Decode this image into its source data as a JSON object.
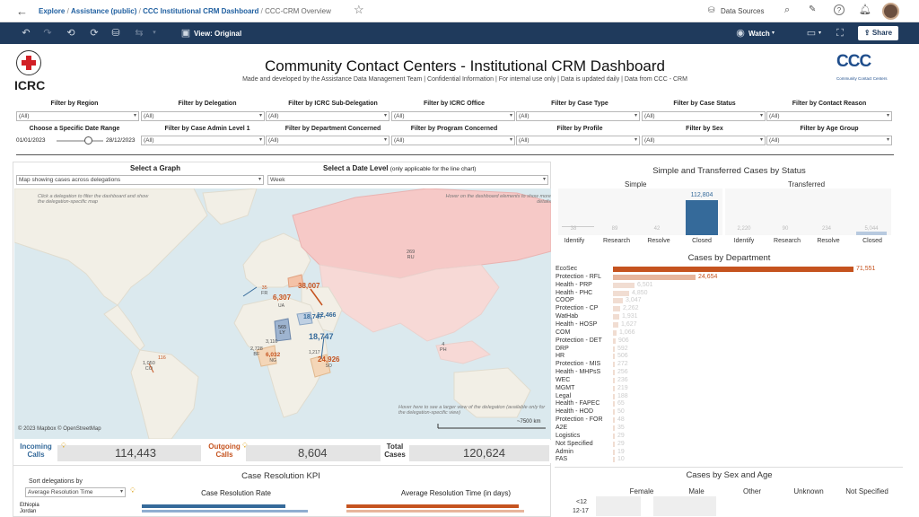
{
  "topbar": {
    "breadcrumbs": [
      "Explore",
      "Assistance (public)",
      "CCC Institutional CRM Dashboard",
      "CCC-CRM Overview"
    ],
    "data_sources": "Data Sources"
  },
  "toolbar": {
    "view": "View: Original",
    "watch": "Watch",
    "share": "Share"
  },
  "header": {
    "logo_text": "ICRC",
    "title": "Community Contact Centers - Institutional CRM Dashboard",
    "subtitle": "Made and developed by the Assistance Data Management Team | Confidential Information | For internal use only | Data is updated daily | Data from CCC - CRM",
    "ccc_logo": "CCC",
    "ccc_caption": "Community Contact Centers"
  },
  "filters": {
    "row1": [
      {
        "label": "Filter by Region",
        "value": "(All)"
      },
      {
        "label": "Filter by Delegation",
        "value": "(All)"
      },
      {
        "label": "Filter by ICRC Sub-Delegation",
        "value": "(All)"
      },
      {
        "label": "Filter by ICRC Office",
        "value": "(All)"
      },
      {
        "label": "Filter by Case Type",
        "value": "(All)"
      },
      {
        "label": "Filter by Case Status",
        "value": "(All)"
      },
      {
        "label": "Filter by Contact Reason",
        "value": "(All)"
      }
    ],
    "date_label": "Choose a Specific Date Range",
    "date_start": "01/01/2023",
    "date_end": "28/12/2023",
    "row2": [
      {
        "label": "Filter by Case Admin Level 1",
        "value": "(All)"
      },
      {
        "label": "Filter by Department Concerned",
        "value": "(All)"
      },
      {
        "label": "Filter by Program Concerned",
        "value": "(All)"
      },
      {
        "label": "Filter by Profile",
        "value": "(All)"
      },
      {
        "label": "Filter by Sex",
        "value": "(All)"
      },
      {
        "label": "Filter by Age Group",
        "value": "(All)"
      }
    ]
  },
  "graph": {
    "select_graph": "Select a Graph",
    "select_date": "Select a Date Level",
    "select_date_note": "(only applicable for the line chart)",
    "graph_value": "Map showing cases across delegations",
    "date_value": "Week"
  },
  "map": {
    "note_left": "Click a delegation to filter the dashboard and show the delegation-specific map",
    "note_right": "Hover on the dashboard elements to show more details",
    "note_bottom": "Hover here to see a larger view of the delegation (available only for the delegation-specific view)",
    "scale": "~7500 km",
    "credit": "© 2023 Mapbox  © OpenStreetMap",
    "labels": [
      {
        "v": "269",
        "c": "RU"
      },
      {
        "v": "38,007",
        "c": ""
      },
      {
        "v": "6,307",
        "c": "UA"
      },
      {
        "v": "35",
        "c": "FR"
      },
      {
        "v": "18,747",
        "c": ""
      },
      {
        "v": "12,466",
        "c": ""
      },
      {
        "v": "18,747",
        "c": "IQ"
      },
      {
        "v": "3,110",
        "c": ""
      },
      {
        "v": "2,728",
        "c": "BF"
      },
      {
        "v": "6,032",
        "c": "NG"
      },
      {
        "v": "1,050",
        "c": "CO"
      },
      {
        "v": "116",
        "c": ""
      },
      {
        "v": "24,926",
        "c": "SO"
      },
      {
        "v": "4",
        "c": "PH"
      },
      {
        "v": "565",
        "c": "LY"
      },
      {
        "v": "1,217",
        "c": ""
      }
    ]
  },
  "kpis": [
    {
      "label": "Incoming Calls",
      "value": "114,443"
    },
    {
      "label": "Outgoing Calls",
      "value": "8,604"
    },
    {
      "label": "Total Cases",
      "value": "120,624"
    }
  ],
  "status": {
    "title": "Simple and Transferred Cases by Status",
    "simple": "Simple",
    "transferred": "Transferred",
    "categories": [
      "Identify",
      "Research",
      "Resolve",
      "Closed"
    ],
    "simple_values": [
      "38",
      "89",
      "42",
      "112,804"
    ],
    "transferred_values": [
      "2,220",
      "90",
      "234",
      "5,044"
    ]
  },
  "departments": {
    "title": "Cases by Department",
    "items": [
      {
        "name": "EcoSec",
        "value": 71551,
        "label": "71,551"
      },
      {
        "name": "Protection - RFL",
        "value": 24654,
        "label": "24,654"
      },
      {
        "name": "Health - PRP",
        "value": 6501,
        "label": "6,501"
      },
      {
        "name": "Health - PHC",
        "value": 4850,
        "label": "4,850"
      },
      {
        "name": "COOP",
        "value": 3047,
        "label": "3,047"
      },
      {
        "name": "Protection - CP",
        "value": 2262,
        "label": "2,262"
      },
      {
        "name": "WatHab",
        "value": 1931,
        "label": "1,931"
      },
      {
        "name": "Health - HOSP",
        "value": 1627,
        "label": "1,627"
      },
      {
        "name": "COM",
        "value": 1066,
        "label": "1,066"
      },
      {
        "name": "Protection - DET",
        "value": 906,
        "label": "906"
      },
      {
        "name": "DRP",
        "value": 592,
        "label": "592"
      },
      {
        "name": "HR",
        "value": 506,
        "label": "506"
      },
      {
        "name": "Protection - MIS",
        "value": 272,
        "label": "272"
      },
      {
        "name": "Health - MHPsS",
        "value": 256,
        "label": "256"
      },
      {
        "name": "WEC",
        "value": 236,
        "label": "236"
      },
      {
        "name": "MGMT",
        "value": 219,
        "label": "219"
      },
      {
        "name": "Legal",
        "value": 188,
        "label": "188"
      },
      {
        "name": "Health - FAPEC",
        "value": 65,
        "label": "65"
      },
      {
        "name": "Health - HOD",
        "value": 50,
        "label": "50"
      },
      {
        "name": "Protection - FOR",
        "value": 48,
        "label": "48"
      },
      {
        "name": "A2E",
        "value": 35,
        "label": "35"
      },
      {
        "name": "Logistics",
        "value": 29,
        "label": "29"
      },
      {
        "name": "Not Specified",
        "value": 29,
        "label": "29"
      },
      {
        "name": "Admin",
        "value": 19,
        "label": "19"
      },
      {
        "name": "FAS",
        "value": 10,
        "label": "10"
      }
    ]
  },
  "kpi_section": {
    "title": "Case Resolution KPI",
    "sort_label": "Sort delegations by",
    "sort_value": "Average Resolution Time",
    "rate_title": "Case Resolution Rate",
    "time_title": "Average Resolution Time (in days)",
    "rows": [
      "Ethiopia",
      "Jordan"
    ]
  },
  "sexage": {
    "title": "Cases by Sex and Age",
    "cols": [
      "Female",
      "Male",
      "Other",
      "Unknown",
      "Not Specified"
    ],
    "rows": [
      "<12",
      "12-17"
    ]
  },
  "colors": {
    "navy": "#1f3a5c",
    "blue": "#356a9a",
    "orange": "#c5531f",
    "light_orange": "#e7b59c"
  }
}
